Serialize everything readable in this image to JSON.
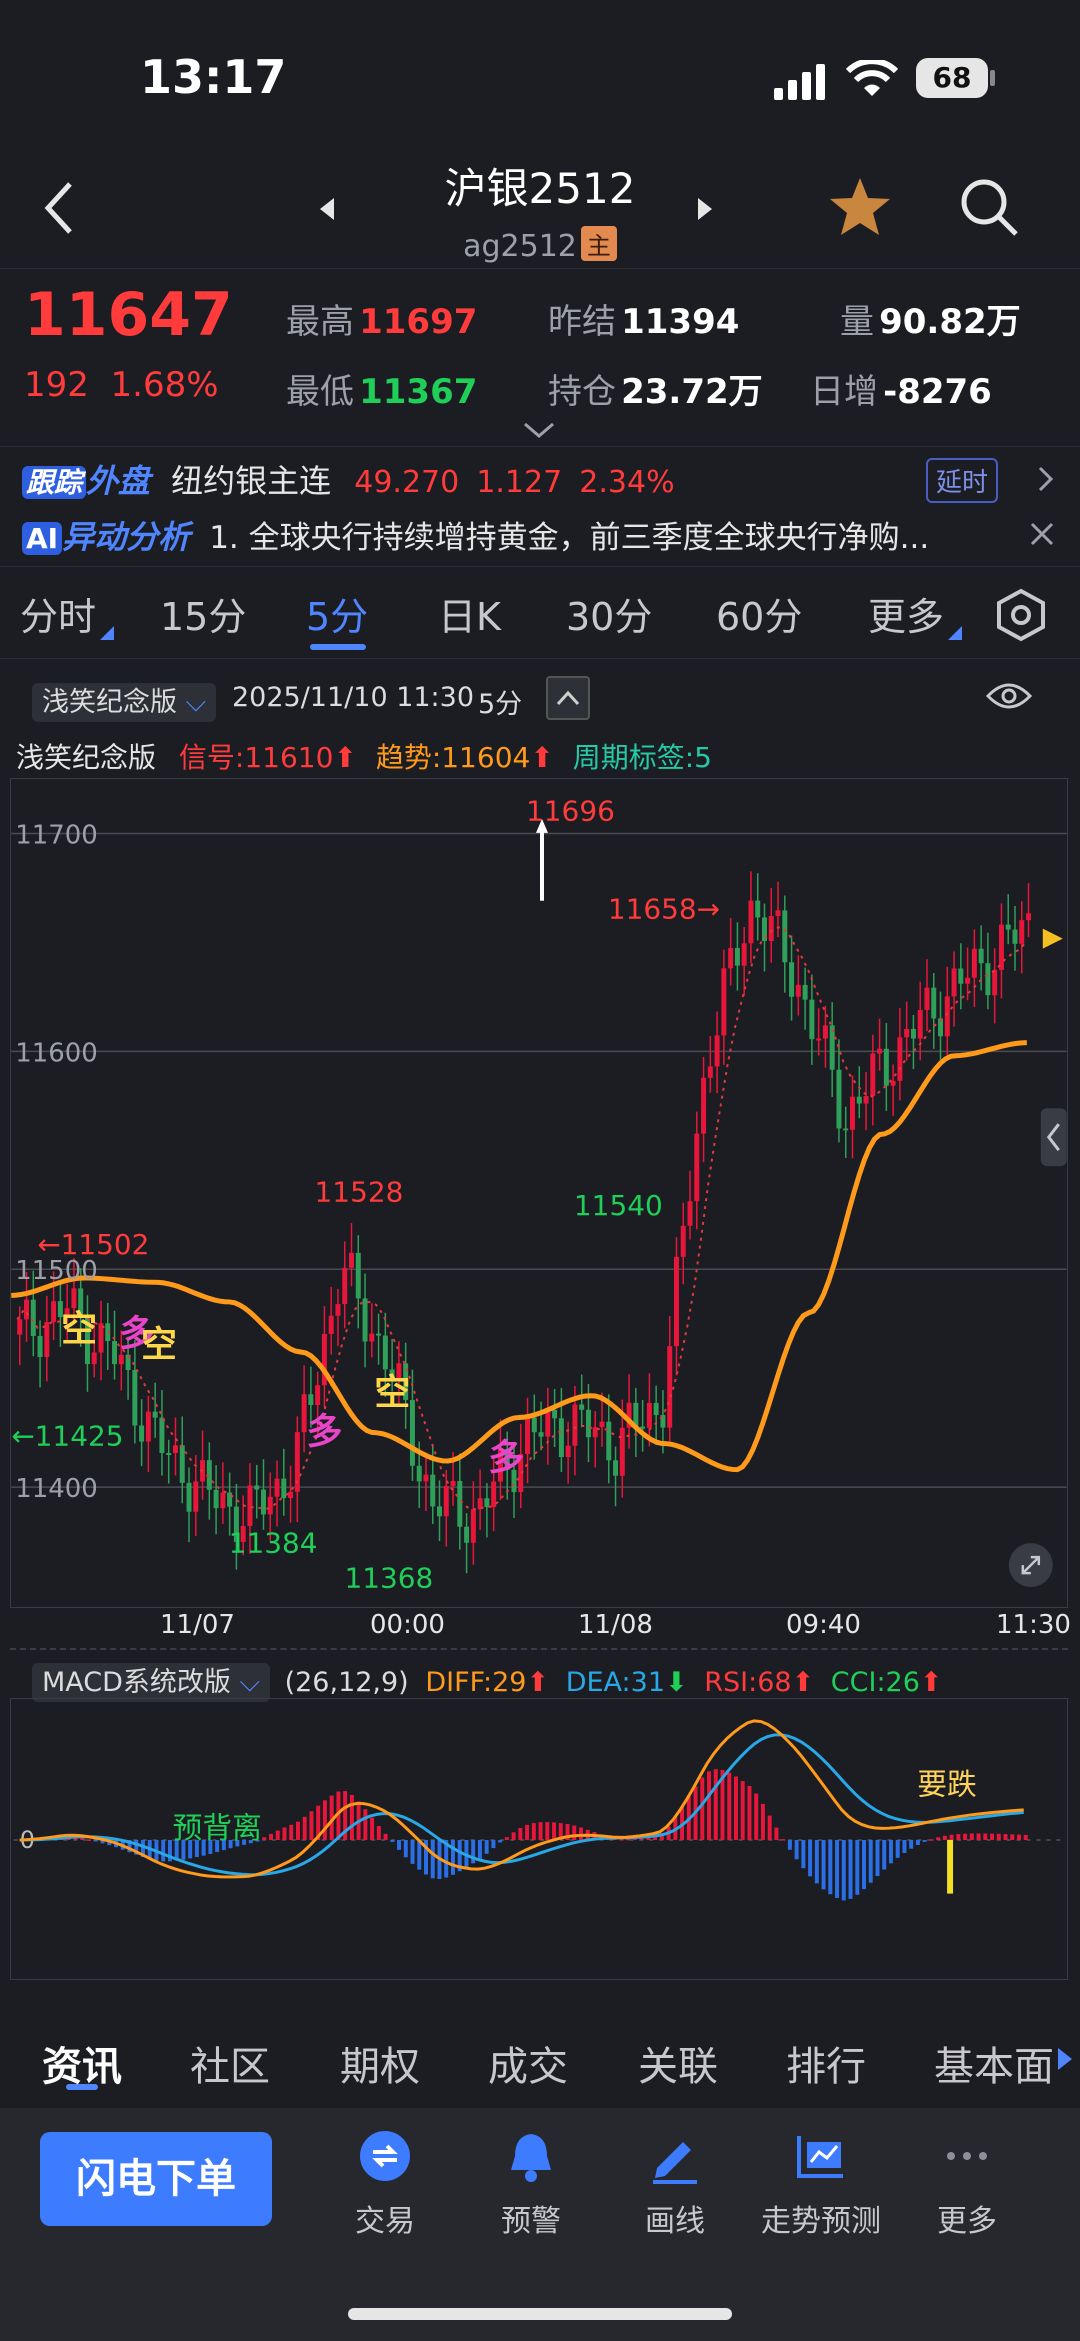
{
  "status": {
    "time": "13:17",
    "battery": "68"
  },
  "header": {
    "title": "沪银2512",
    "code": "ag2512",
    "badge": "主"
  },
  "quote": {
    "price": "11647",
    "change": "192",
    "change_pct": "1.68%",
    "high_label": "最高",
    "high": "11697",
    "low_label": "最低",
    "low": "11367",
    "prev_label": "昨结",
    "prev": "11394",
    "oi_label": "持仓",
    "oi": "23.72万",
    "vol_label": "量",
    "vol": "90.82万",
    "daily_label": "日增",
    "daily": "-8276"
  },
  "tracking": {
    "tag1": "跟踪",
    "tag2": "外盘",
    "name": "纽约银主连",
    "price": "49.270",
    "chg": "1.127",
    "pct": "2.34%",
    "delay": "延时"
  },
  "ai": {
    "tag": "AI",
    "label": "异动分析",
    "text": "1. 全球央行持续增持黄金，前三季度全球央行净购..."
  },
  "tabs": [
    "分时",
    "15分",
    "5分",
    "日K",
    "30分",
    "60分",
    "更多"
  ],
  "chart_head": {
    "version": "浅笑纪念版",
    "datetime": "2025/11/10 11:30",
    "period": "5分",
    "name": "浅笑纪念版",
    "signal": "信号:11610",
    "trend": "趋势:11604",
    "cycle": "周期标签:5"
  },
  "chart_data": {
    "type": "candlestick",
    "y_ticks": [
      "11700",
      "11600",
      "11500",
      "11400"
    ],
    "ylim": [
      11345,
      11725
    ],
    "x_ticks": [
      "11/07",
      "00:00",
      "11/08",
      "09:40",
      "11:30"
    ],
    "annotations": {
      "high": "11696",
      "last": "11658→",
      "left_high": "←11502",
      "left_low": "←11425",
      "mid_high": "11528",
      "low1": "11384",
      "low2": "11368",
      "recover": "11540"
    },
    "signals": [
      "空",
      "多",
      "空",
      "多",
      "空",
      "多"
    ],
    "trend_line": [
      11488,
      11496,
      11494,
      11485,
      11462,
      11425,
      11412,
      11432,
      11442,
      11420,
      11408,
      11480,
      11562,
      11598,
      11604
    ],
    "close": [
      11470,
      11482,
      11462,
      11420,
      11398,
      11386,
      11410,
      11500,
      11460,
      11392,
      11388,
      11422,
      11430,
      11420,
      11438,
      11600,
      11670,
      11630,
      11570,
      11598,
      11622,
      11640,
      11658
    ]
  },
  "macd": {
    "selector": "MACD系统改版",
    "params": "(26,12,9)",
    "diff": "DIFF:29",
    "dea": "DEA:31",
    "rsi": "RSI:68",
    "cci": "CCI:26",
    "zero": "0",
    "label_left": "预背离",
    "label_right": "要跌"
  },
  "bottom_tabs": [
    "资讯",
    "社区",
    "期权",
    "成交",
    "关联",
    "排行",
    "基本面"
  ],
  "toolbar": {
    "flash": "闪电下单",
    "tools": [
      "交易",
      "预警",
      "画线",
      "走势预测",
      "更多"
    ]
  }
}
